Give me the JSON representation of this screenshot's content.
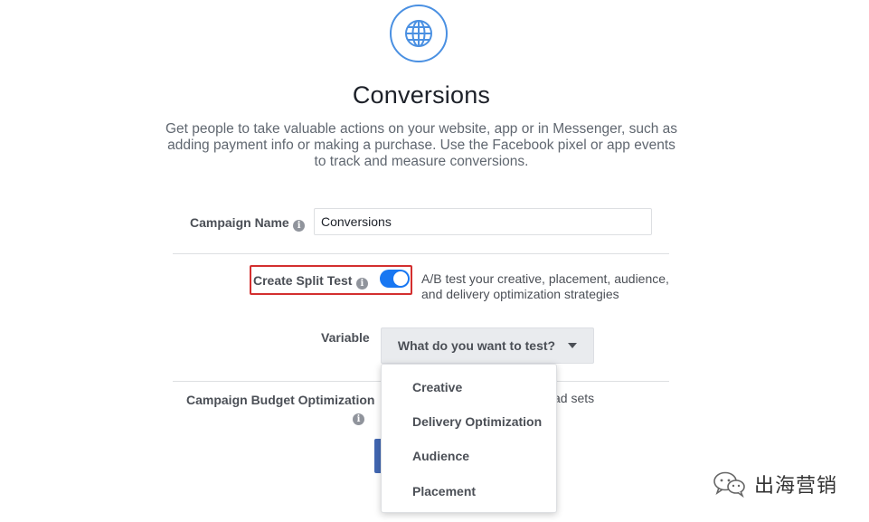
{
  "header": {
    "icon": "globe-icon",
    "title": "Conversions",
    "description": "Get people to take valuable actions on your website, app or in Messenger, such as adding payment info or making a purchase. Use the Facebook pixel or app events to track and measure conversions."
  },
  "campaign_name": {
    "label": "Campaign Name",
    "value": "Conversions"
  },
  "split_test": {
    "label": "Create Split Test",
    "enabled": true,
    "description": "A/B test your creative, placement, audience, and delivery optimization strategies"
  },
  "variable": {
    "label": "Variable",
    "button_label": "What do you want to test?",
    "options": [
      "Creative",
      "Delivery Optimization",
      "Audience",
      "Placement"
    ]
  },
  "budget_optimization": {
    "label": "Campaign Budget Optimization",
    "partial_text": "ad sets"
  },
  "watermark": {
    "text": "出海营销"
  },
  "colors": {
    "accent": "#1877f2",
    "highlight_border": "#d32f2f",
    "icon_ring": "#4a90e2"
  }
}
